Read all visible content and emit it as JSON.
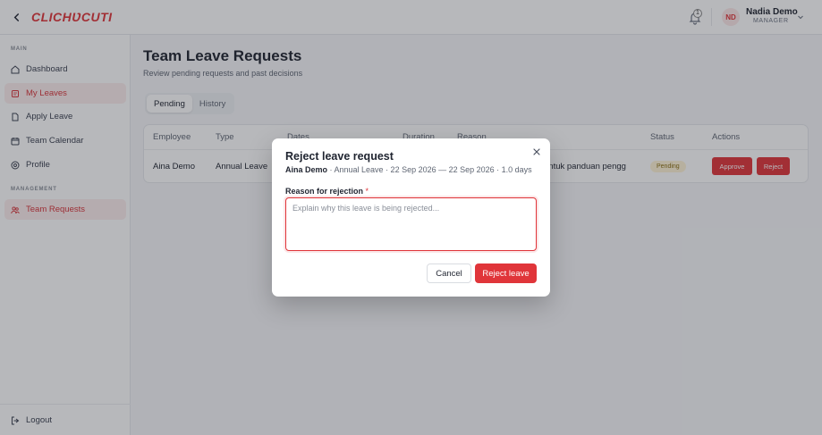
{
  "app": {
    "logo_text": "CLICHƲCUTI"
  },
  "header": {
    "notification_count": "1",
    "user": {
      "initials": "ND",
      "name": "Nadia Demo",
      "role": "MANAGER"
    }
  },
  "sidebar": {
    "main_label": "MAIN",
    "main_items": [
      {
        "label": "Dashboard",
        "icon": "home-icon"
      },
      {
        "label": "My Leaves",
        "icon": "file-icon",
        "active": true
      },
      {
        "label": "Apply Leave",
        "icon": "document-icon"
      },
      {
        "label": "Team Calendar",
        "icon": "calendar-icon"
      },
      {
        "label": "Profile",
        "icon": "profile-icon"
      }
    ],
    "management_label": "MANAGEMENT",
    "management_items": [
      {
        "label": "Team Requests",
        "icon": "team-icon",
        "active": true
      }
    ],
    "logout_label": "Logout"
  },
  "page": {
    "title": "Team Leave Requests",
    "subtitle": "Review pending requests and past decisions",
    "tabs": [
      {
        "label": "Pending",
        "active": true
      },
      {
        "label": "History",
        "active": false
      }
    ]
  },
  "table": {
    "columns": [
      "Employee",
      "Type",
      "Dates",
      "Duration",
      "Reason",
      "Status",
      "Actions"
    ],
    "rows": [
      {
        "employee": "Aina Demo",
        "type": "Annual Leave",
        "reason_visible": "untuk panduan pengg",
        "status": "Pending",
        "approve_label": "Approve",
        "reject_label": "Reject"
      }
    ]
  },
  "modal": {
    "title": "Reject leave request",
    "employee": "Aina Demo",
    "meta": " · Annual Leave · 22 Sep 2026 — 22 Sep 2026 · 1.0 days",
    "field_label": "Reason for rejection",
    "required_mark": "*",
    "placeholder": "Explain why this leave is being rejected...",
    "value": "",
    "cancel_label": "Cancel",
    "submit_label": "Reject leave"
  },
  "colors": {
    "accent": "#e0353a",
    "active_bg": "#fdeeee",
    "pending_bg": "#fff4d6"
  }
}
